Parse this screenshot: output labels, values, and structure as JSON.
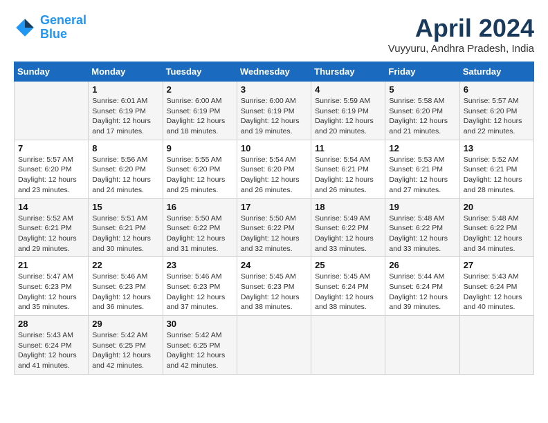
{
  "header": {
    "logo_line1": "General",
    "logo_line2": "Blue",
    "month_title": "April 2024",
    "location": "Vuyyuru, Andhra Pradesh, India"
  },
  "days_of_week": [
    "Sunday",
    "Monday",
    "Tuesday",
    "Wednesday",
    "Thursday",
    "Friday",
    "Saturday"
  ],
  "weeks": [
    [
      {
        "day": "",
        "info": ""
      },
      {
        "day": "1",
        "info": "Sunrise: 6:01 AM\nSunset: 6:19 PM\nDaylight: 12 hours\nand 17 minutes."
      },
      {
        "day": "2",
        "info": "Sunrise: 6:00 AM\nSunset: 6:19 PM\nDaylight: 12 hours\nand 18 minutes."
      },
      {
        "day": "3",
        "info": "Sunrise: 6:00 AM\nSunset: 6:19 PM\nDaylight: 12 hours\nand 19 minutes."
      },
      {
        "day": "4",
        "info": "Sunrise: 5:59 AM\nSunset: 6:19 PM\nDaylight: 12 hours\nand 20 minutes."
      },
      {
        "day": "5",
        "info": "Sunrise: 5:58 AM\nSunset: 6:20 PM\nDaylight: 12 hours\nand 21 minutes."
      },
      {
        "day": "6",
        "info": "Sunrise: 5:57 AM\nSunset: 6:20 PM\nDaylight: 12 hours\nand 22 minutes."
      }
    ],
    [
      {
        "day": "7",
        "info": "Sunrise: 5:57 AM\nSunset: 6:20 PM\nDaylight: 12 hours\nand 23 minutes."
      },
      {
        "day": "8",
        "info": "Sunrise: 5:56 AM\nSunset: 6:20 PM\nDaylight: 12 hours\nand 24 minutes."
      },
      {
        "day": "9",
        "info": "Sunrise: 5:55 AM\nSunset: 6:20 PM\nDaylight: 12 hours\nand 25 minutes."
      },
      {
        "day": "10",
        "info": "Sunrise: 5:54 AM\nSunset: 6:20 PM\nDaylight: 12 hours\nand 26 minutes."
      },
      {
        "day": "11",
        "info": "Sunrise: 5:54 AM\nSunset: 6:21 PM\nDaylight: 12 hours\nand 26 minutes."
      },
      {
        "day": "12",
        "info": "Sunrise: 5:53 AM\nSunset: 6:21 PM\nDaylight: 12 hours\nand 27 minutes."
      },
      {
        "day": "13",
        "info": "Sunrise: 5:52 AM\nSunset: 6:21 PM\nDaylight: 12 hours\nand 28 minutes."
      }
    ],
    [
      {
        "day": "14",
        "info": "Sunrise: 5:52 AM\nSunset: 6:21 PM\nDaylight: 12 hours\nand 29 minutes."
      },
      {
        "day": "15",
        "info": "Sunrise: 5:51 AM\nSunset: 6:21 PM\nDaylight: 12 hours\nand 30 minutes."
      },
      {
        "day": "16",
        "info": "Sunrise: 5:50 AM\nSunset: 6:22 PM\nDaylight: 12 hours\nand 31 minutes."
      },
      {
        "day": "17",
        "info": "Sunrise: 5:50 AM\nSunset: 6:22 PM\nDaylight: 12 hours\nand 32 minutes."
      },
      {
        "day": "18",
        "info": "Sunrise: 5:49 AM\nSunset: 6:22 PM\nDaylight: 12 hours\nand 33 minutes."
      },
      {
        "day": "19",
        "info": "Sunrise: 5:48 AM\nSunset: 6:22 PM\nDaylight: 12 hours\nand 33 minutes."
      },
      {
        "day": "20",
        "info": "Sunrise: 5:48 AM\nSunset: 6:22 PM\nDaylight: 12 hours\nand 34 minutes."
      }
    ],
    [
      {
        "day": "21",
        "info": "Sunrise: 5:47 AM\nSunset: 6:23 PM\nDaylight: 12 hours\nand 35 minutes."
      },
      {
        "day": "22",
        "info": "Sunrise: 5:46 AM\nSunset: 6:23 PM\nDaylight: 12 hours\nand 36 minutes."
      },
      {
        "day": "23",
        "info": "Sunrise: 5:46 AM\nSunset: 6:23 PM\nDaylight: 12 hours\nand 37 minutes."
      },
      {
        "day": "24",
        "info": "Sunrise: 5:45 AM\nSunset: 6:23 PM\nDaylight: 12 hours\nand 38 minutes."
      },
      {
        "day": "25",
        "info": "Sunrise: 5:45 AM\nSunset: 6:24 PM\nDaylight: 12 hours\nand 38 minutes."
      },
      {
        "day": "26",
        "info": "Sunrise: 5:44 AM\nSunset: 6:24 PM\nDaylight: 12 hours\nand 39 minutes."
      },
      {
        "day": "27",
        "info": "Sunrise: 5:43 AM\nSunset: 6:24 PM\nDaylight: 12 hours\nand 40 minutes."
      }
    ],
    [
      {
        "day": "28",
        "info": "Sunrise: 5:43 AM\nSunset: 6:24 PM\nDaylight: 12 hours\nand 41 minutes."
      },
      {
        "day": "29",
        "info": "Sunrise: 5:42 AM\nSunset: 6:25 PM\nDaylight: 12 hours\nand 42 minutes."
      },
      {
        "day": "30",
        "info": "Sunrise: 5:42 AM\nSunset: 6:25 PM\nDaylight: 12 hours\nand 42 minutes."
      },
      {
        "day": "",
        "info": ""
      },
      {
        "day": "",
        "info": ""
      },
      {
        "day": "",
        "info": ""
      },
      {
        "day": "",
        "info": ""
      }
    ]
  ]
}
